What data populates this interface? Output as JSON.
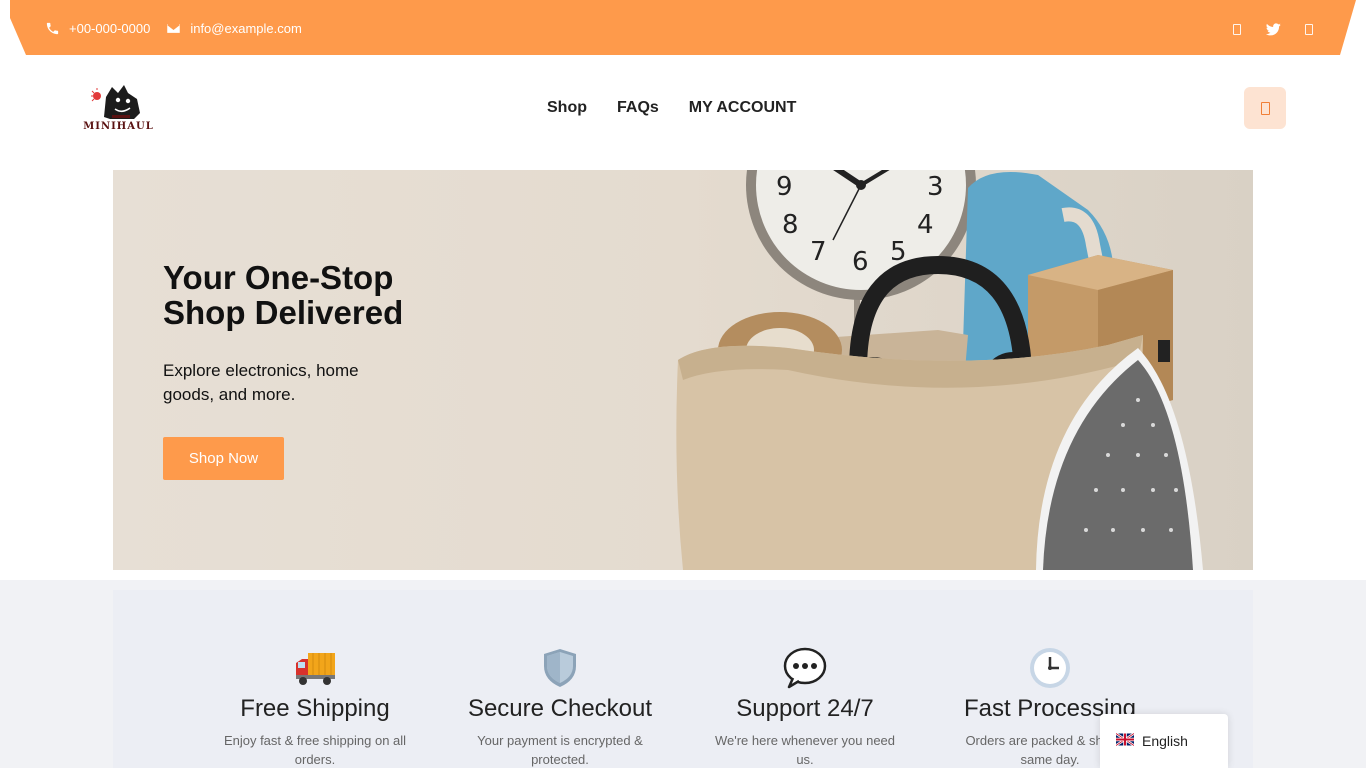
{
  "topbar": {
    "phone": "+00-000-0000",
    "email": "info@example.com",
    "icons": [
      "phone-icon",
      "envelope-icon",
      "facebook-icon",
      "twitter-icon",
      "instagram-icon"
    ]
  },
  "header": {
    "logo_text": "MINIHAUL",
    "nav": [
      "Shop",
      "FAQs",
      "MY ACCOUNT"
    ],
    "cart_icon": "shopping-bag-icon"
  },
  "hero": {
    "title": "Your One-Stop Shop Delivered",
    "subtitle": "Explore electronics, home goods, and more.",
    "button": "Shop Now"
  },
  "features": [
    {
      "icon": "🚚",
      "title": "Free Shipping",
      "text": "Enjoy fast & free shipping on all orders."
    },
    {
      "icon": "🛡️",
      "title": "Secure Checkout",
      "text": "Your payment is encrypted & protected."
    },
    {
      "icon": "💬",
      "title": "Support 24/7",
      "text": "We're here whenever you need us."
    },
    {
      "icon": "🕒",
      "title": "Fast Processing",
      "text": "Orders are packed & shipped same day."
    }
  ],
  "language": {
    "label": "English"
  },
  "colors": {
    "accent": "#fe9a4b",
    "accent_light": "#fde3d2",
    "feature_bg": "#eceef4"
  }
}
